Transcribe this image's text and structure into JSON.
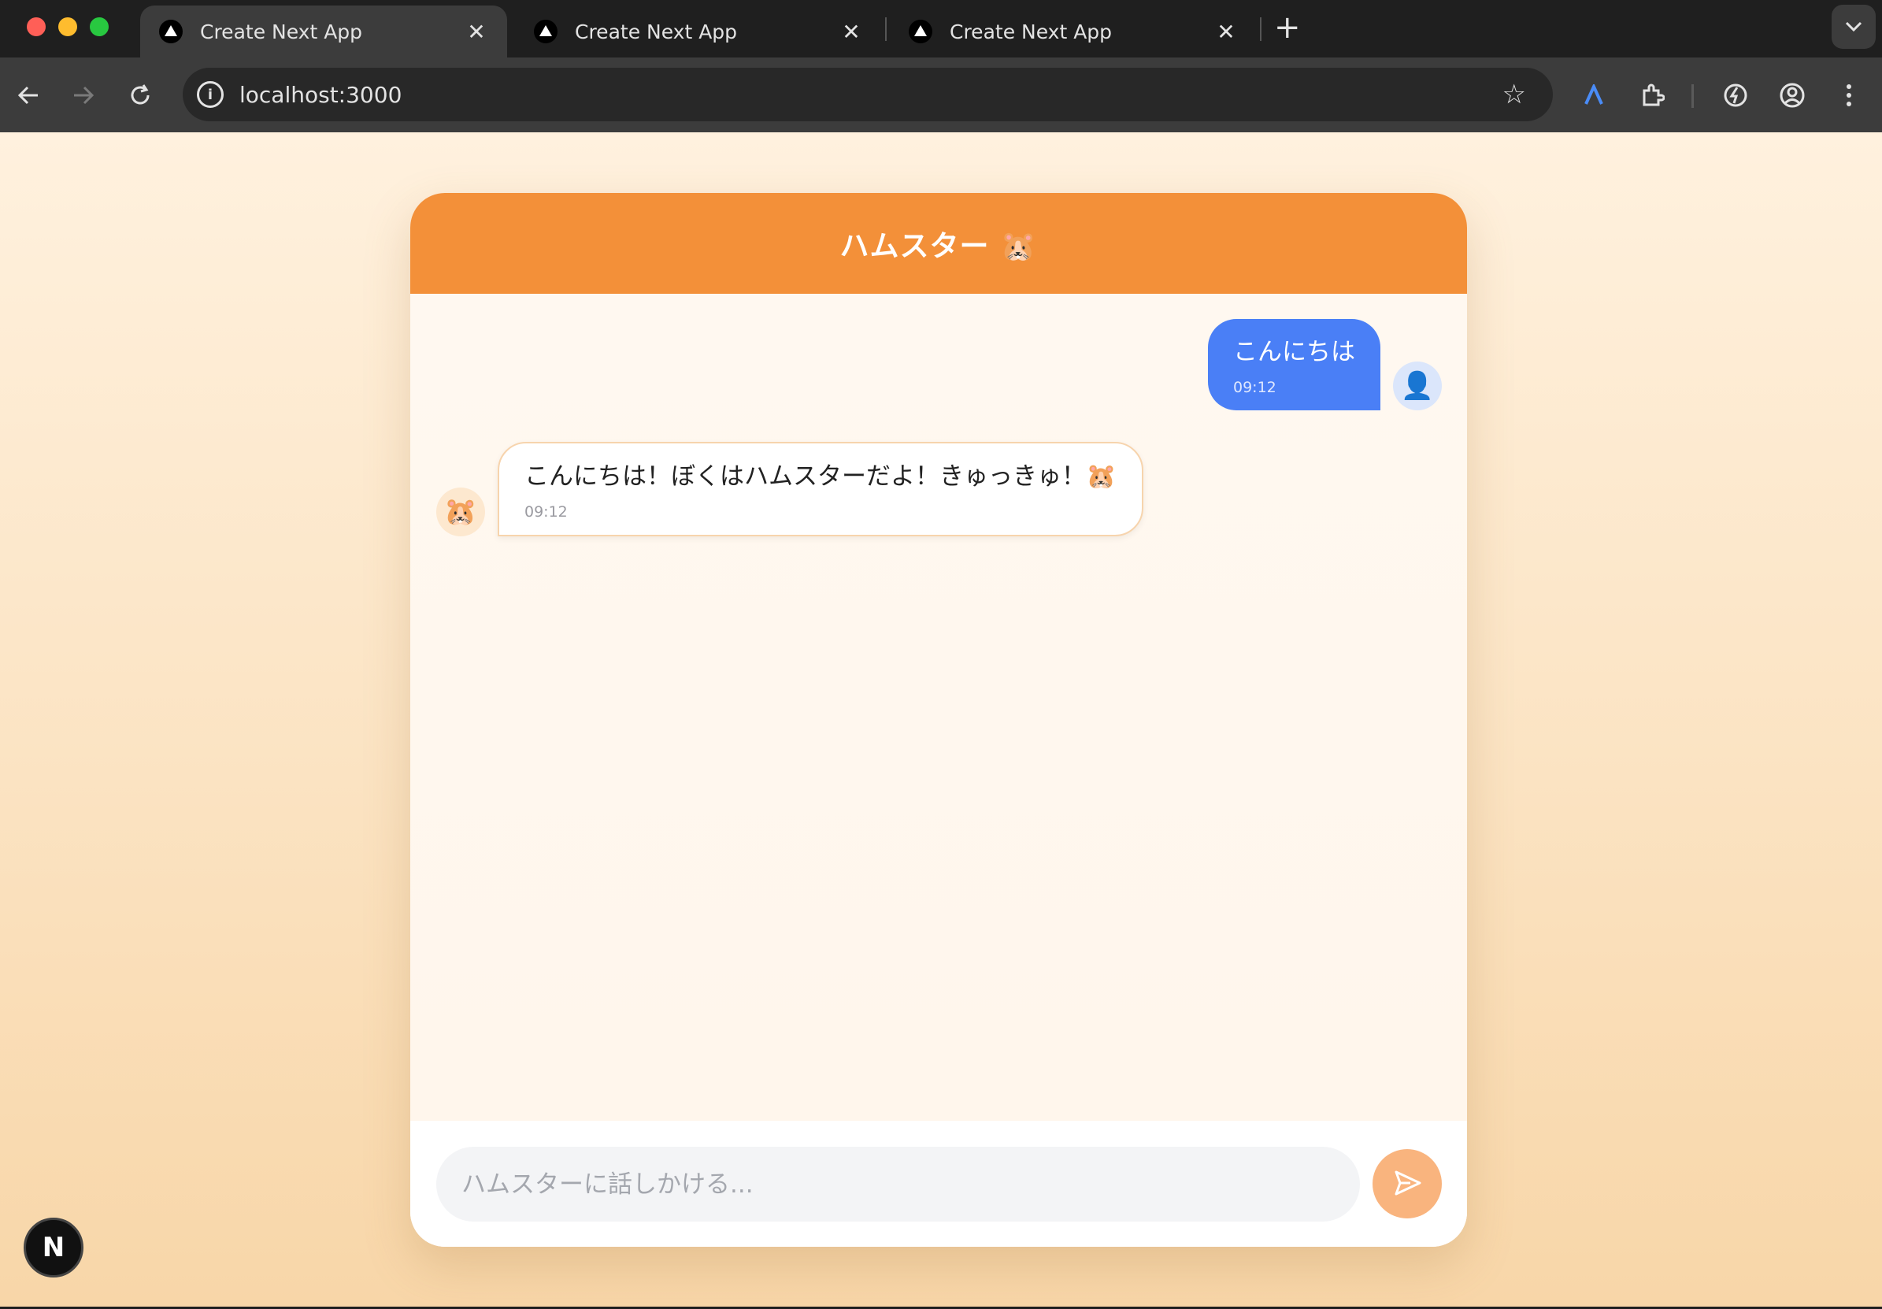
{
  "browser": {
    "tabs": [
      {
        "title": "Create Next App",
        "active": true
      },
      {
        "title": "Create Next App",
        "active": false
      },
      {
        "title": "Create Next App",
        "active": false
      }
    ],
    "tab_close_glyph": "✕",
    "new_tab_glyph": "+",
    "url": "localhost:3000",
    "icons": [
      "back-icon",
      "forward-icon",
      "reload-icon",
      "site-info-icon",
      "bookmark-star-icon",
      "extension-a-icon",
      "extensions-puzzle-icon",
      "performance-icon",
      "profile-icon",
      "menu-kebab-icon",
      "tab-search-icon"
    ]
  },
  "chat": {
    "title": "ハムスター 🐹",
    "messages": [
      {
        "sender": "user",
        "text": "こんにちは",
        "time": "09:12",
        "avatar": "👤"
      },
      {
        "sender": "bot",
        "text": "こんにちは！ぼくはハムスターだよ！きゅっきゅ！🐹",
        "time": "09:12",
        "avatar": "🐹"
      }
    ],
    "input_placeholder": "ハムスターに話しかける...",
    "send_icon": "send-paper-plane-icon"
  },
  "dev_badge": {
    "label": "N"
  },
  "colors": {
    "header": "#f39039",
    "user_bubble": "#4a7ff6",
    "send_button": "#f9b47e",
    "page_gradient_top": "#fff1de",
    "page_gradient_bottom": "#f8d6a8"
  }
}
